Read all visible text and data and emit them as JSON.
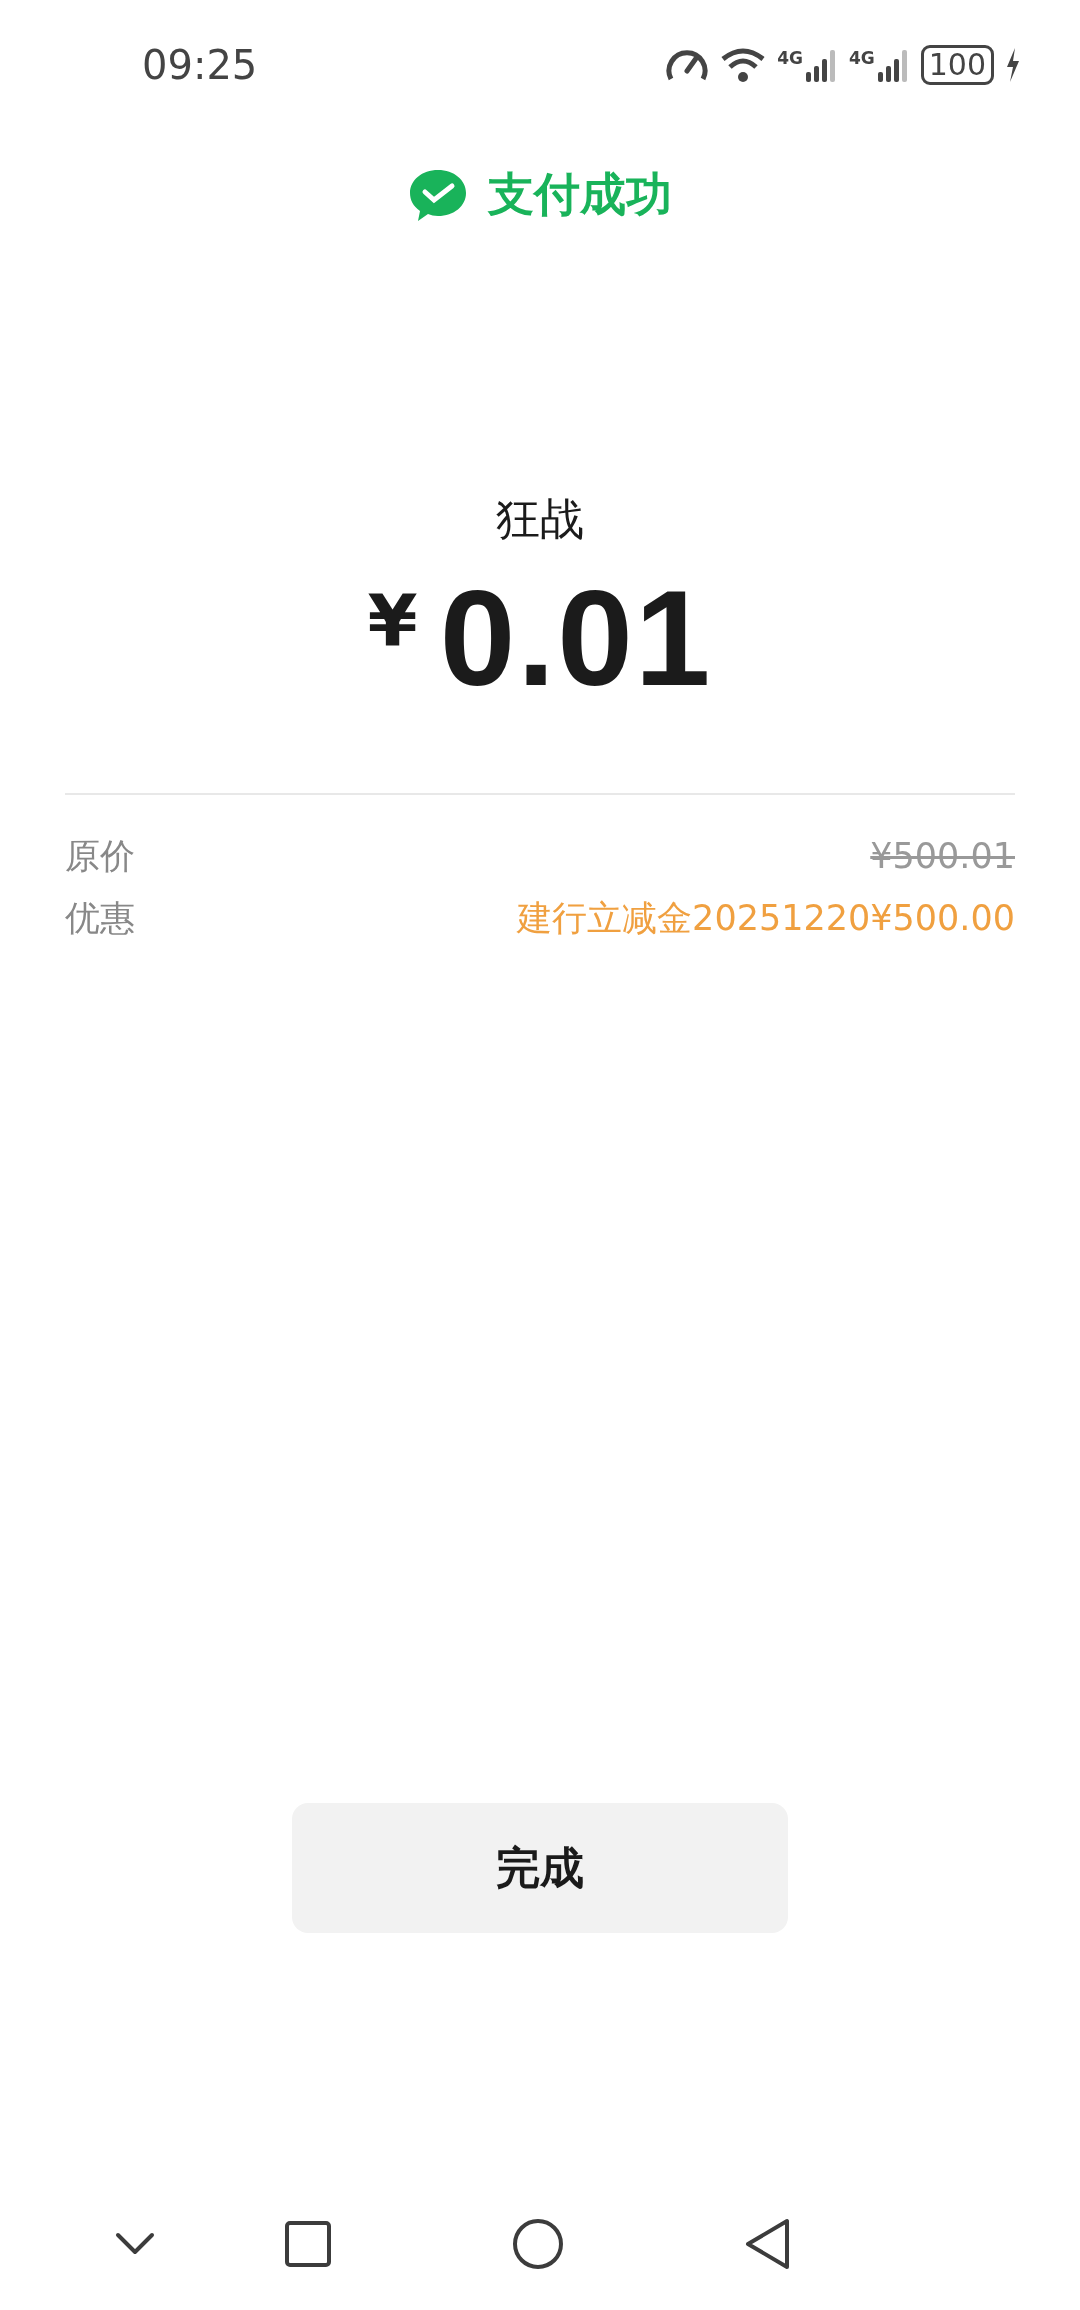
{
  "status_bar": {
    "time": "09:25",
    "network_labels": [
      "4G",
      "4G"
    ],
    "battery": "100",
    "charging": true
  },
  "header": {
    "title": "支付成功"
  },
  "payment": {
    "merchant": "狂战",
    "currency": "¥",
    "amount": "0.01"
  },
  "details": [
    {
      "label": "原价",
      "value": "¥500.01",
      "kind": "struck"
    },
    {
      "label": "优惠",
      "value": "建行立减金20251220¥500.00",
      "kind": "discount"
    }
  ],
  "done_button": {
    "label": "完成"
  }
}
